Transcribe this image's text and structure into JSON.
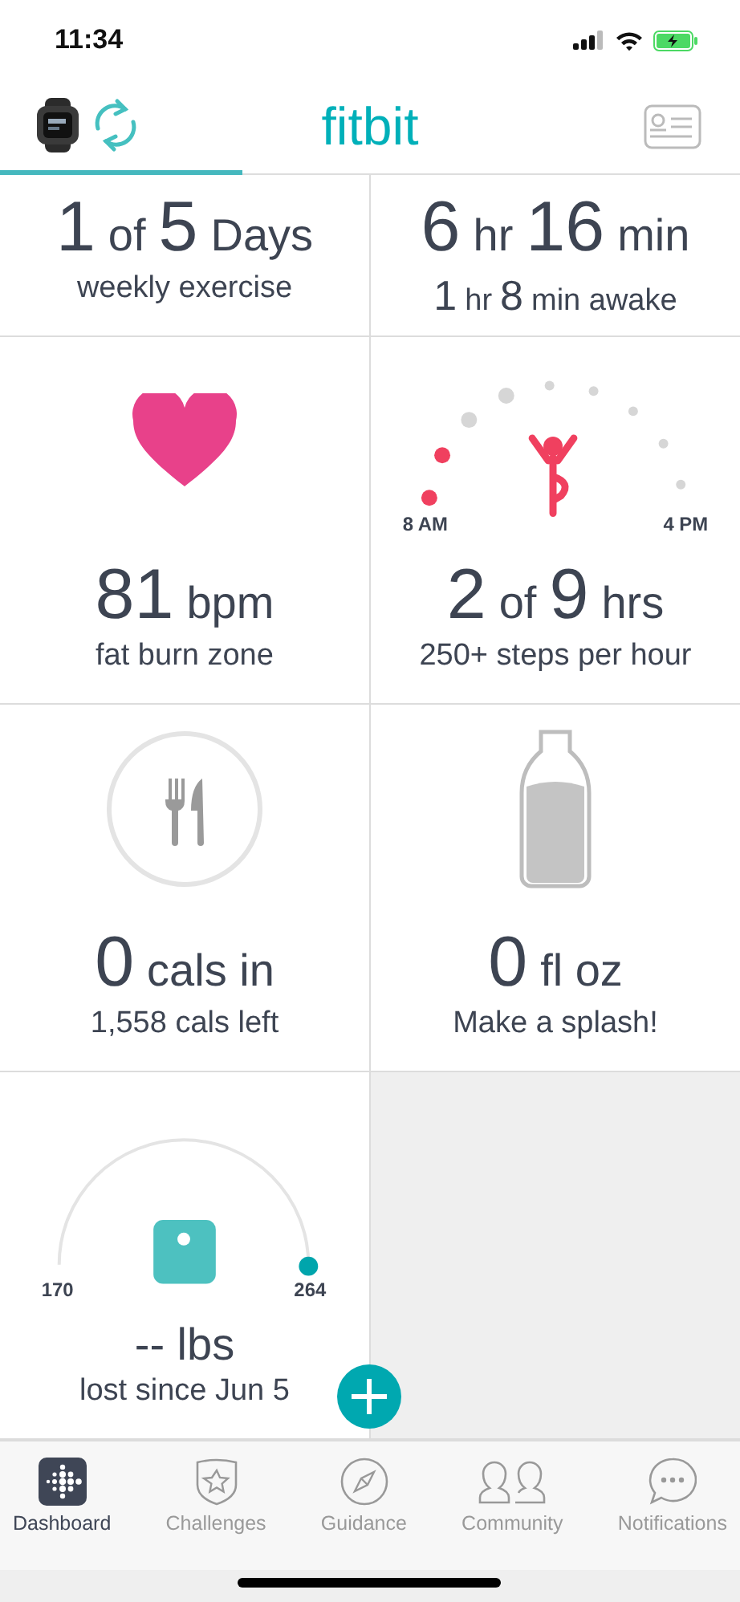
{
  "status_bar": {
    "time": "11:34"
  },
  "header": {
    "title": "fitbit"
  },
  "tile_rows": [
    {
      "tiles": [
        {
          "kind": "exercise",
          "headline": [
            {
              "t": "1",
              "kind": "num"
            },
            {
              "t": "of",
              "kind": "unit"
            },
            {
              "t": "5",
              "kind": "num"
            },
            {
              "t": "Days",
              "kind": "unit"
            }
          ],
          "subtitle": [
            {
              "t": "weekly exercise",
              "kind": "unit"
            }
          ]
        },
        {
          "kind": "sleep",
          "headline": [
            {
              "t": "6",
              "kind": "num"
            },
            {
              "t": "hr",
              "kind": "unit"
            },
            {
              "t": "16",
              "kind": "num"
            },
            {
              "t": "min",
              "kind": "unit"
            }
          ],
          "subtitle": [
            {
              "t": "1",
              "kind": "num"
            },
            {
              "t": "hr",
              "kind": "unit"
            },
            {
              "t": "8",
              "kind": "num"
            },
            {
              "t": "min awake",
              "kind": "unit"
            }
          ]
        }
      ]
    },
    {
      "tiles": [
        {
          "kind": "heart",
          "headline": [
            {
              "t": "81",
              "kind": "num"
            },
            {
              "t": "bpm",
              "kind": "unit"
            }
          ],
          "subtitle": [
            {
              "t": "fat burn zone",
              "kind": "unit"
            }
          ]
        },
        {
          "kind": "active",
          "hours": [
            {
              "active": true
            },
            {
              "active": true
            },
            {
              "active": false
            },
            {
              "active": false
            },
            {
              "active": false
            },
            {
              "active": false
            },
            {
              "active": false
            },
            {
              "active": false
            },
            {
              "active": false
            }
          ],
          "start_label": "8 AM",
          "end_label": "4 PM",
          "headline": [
            {
              "t": "2",
              "kind": "num"
            },
            {
              "t": "of",
              "kind": "unit"
            },
            {
              "t": "9",
              "kind": "num"
            },
            {
              "t": "hrs",
              "kind": "unit"
            }
          ],
          "subtitle": [
            {
              "t": "250+ steps per hour",
              "kind": "unit"
            }
          ]
        }
      ]
    },
    {
      "tiles": [
        {
          "kind": "food",
          "headline": [
            {
              "t": "0",
              "kind": "num"
            },
            {
              "t": "cals in",
              "kind": "unit"
            }
          ],
          "subtitle": [
            {
              "t": "1,558 cals left",
              "kind": "unit"
            }
          ]
        },
        {
          "kind": "water",
          "headline": [
            {
              "t": "0",
              "kind": "num"
            },
            {
              "t": "fl oz",
              "kind": "unit"
            }
          ],
          "subtitle": [
            {
              "t": "Make a splash!",
              "kind": "unit"
            }
          ]
        }
      ]
    },
    {
      "tiles": [
        {
          "kind": "weight",
          "start_label": "170",
          "end_label": "264",
          "headline": [
            {
              "t": "-- lbs",
              "kind": "unit"
            }
          ],
          "subtitle": [
            {
              "t": "lost since Jun 5",
              "kind": "unit"
            }
          ]
        }
      ]
    }
  ],
  "tab_bar": [
    {
      "label": "Dashboard",
      "selected": true
    },
    {
      "label": "Challenges",
      "selected": false
    },
    {
      "label": "Guidance",
      "selected": false
    },
    {
      "label": "Community",
      "selected": false
    },
    {
      "label": "Notifications",
      "selected": false
    }
  ]
}
